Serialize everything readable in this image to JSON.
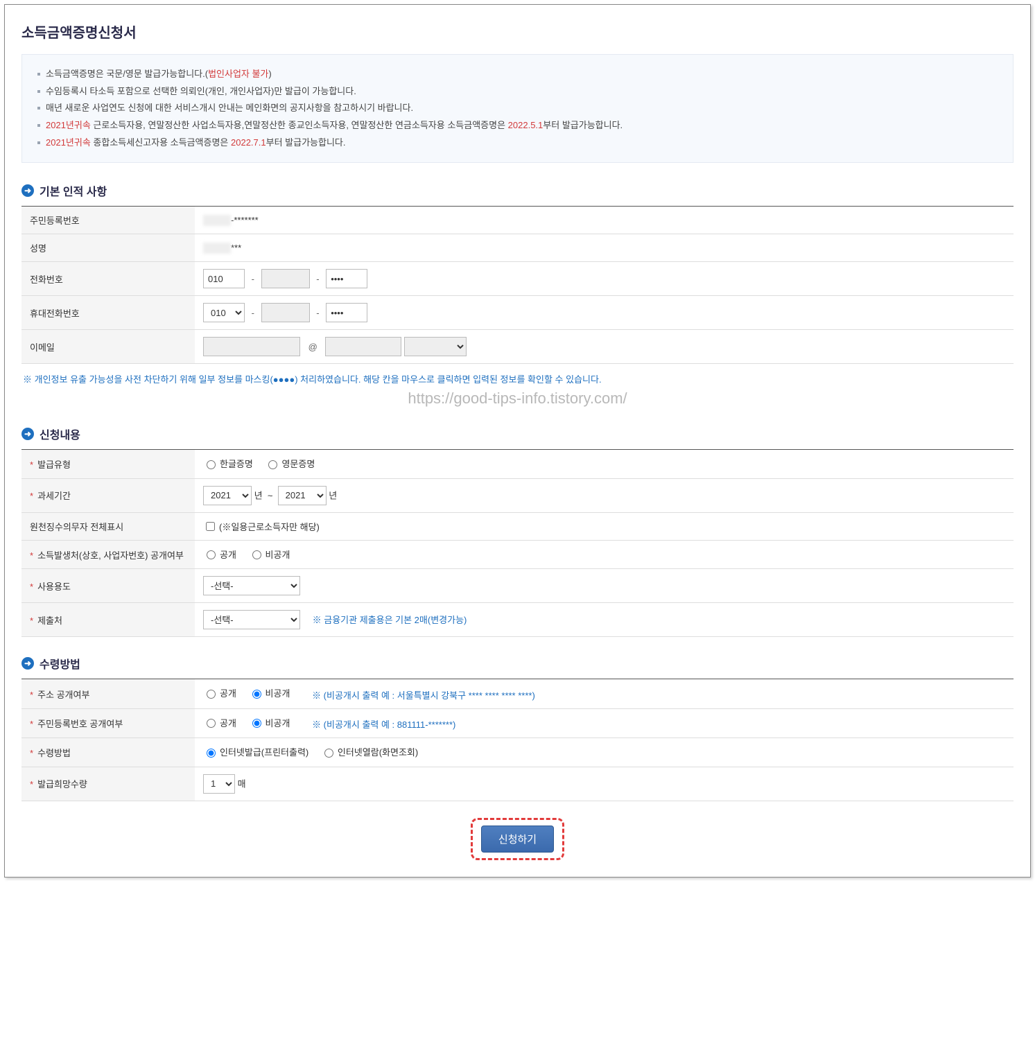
{
  "title": "소득금액증명신청서",
  "notices": [
    {
      "pre": "소득금액증명은 국문/영문 발급가능합니다.(",
      "red": "법인사업자 불가",
      "post": ")"
    },
    {
      "pre": "수임등록시 타소득 포함으로 선택한 의뢰인(개인, 개인사업자)만 발급이 가능합니다.",
      "red": "",
      "post": ""
    },
    {
      "pre": "매년 새로운 사업연도 신청에 대한 서비스개시 안내는 메인화면의 공지사항을 참고하시기 바랍니다.",
      "red": "",
      "post": ""
    },
    {
      "pre": "",
      "red": "2021년귀속",
      "mid": " 근로소득자용, 연말정산한 사업소득자용,연말정산한 종교인소득자용, 연말정산한 연금소득자용 소득금액증명은 ",
      "red2": "2022.5.1",
      "post": "부터 발급가능합니다."
    },
    {
      "pre": "",
      "red": "2021년귀속",
      "mid": " 종합소득세신고자용 소득금액증명은 ",
      "red2": "2022.7.1",
      "post": "부터 발급가능합니다."
    }
  ],
  "sections": {
    "personal": "기본 인적 사항",
    "apply": "신청내용",
    "receive": "수령방법"
  },
  "personal": {
    "rrn_label": "주민등록번호",
    "rrn_value": "-*******",
    "name_label": "성명",
    "name_value": "***",
    "phone_label": "전화번호",
    "phone1": "010",
    "phone2": "",
    "phone3": "••••",
    "mobile_label": "휴대전화번호",
    "mobile1": "010",
    "mobile2": "",
    "mobile3": "••••",
    "email_label": "이메일",
    "email_id": "",
    "email_domain": "",
    "email_select": ""
  },
  "masking_note": "개인정보 유출 가능성을 사전 차단하기 위해 일부 정보를 마스킹(●●●●) 처리하였습니다. 해당 칸을 마우스로 클릭하면 입력된 정보를 확인할 수 있습니다.",
  "watermark": "https://good-tips-info.tistory.com/",
  "apply": {
    "type_label": "발급유형",
    "type_kor": "한글증명",
    "type_eng": "영문증명",
    "period_label": "과세기간",
    "year_from": "2021",
    "year_to": "2021",
    "year_unit": "년",
    "tilde": "~",
    "withhold_label": "원천징수의무자 전체표시",
    "withhold_hint": "(※일용근로소득자만 해당)",
    "source_label": "소득발생처(상호, 사업자번호) 공개여부",
    "open": "공개",
    "closed": "비공개",
    "purpose_label": "사용용도",
    "purpose_select": "-선택-",
    "submit_to_label": "제출처",
    "submit_to_select": "-선택-",
    "submit_to_hint": "※ 금융기관 제출용은 기본 2매(변경가능)"
  },
  "receive": {
    "addr_label": "주소 공개여부",
    "addr_hint": "※ (비공개시 출력 예 : 서울특별시 강북구 **** **** **** ****)",
    "rrn_label": "주민등록번호 공개여부",
    "rrn_hint": "※ (비공개시 출력 예 : 881111-*******)",
    "method_label": "수령방법",
    "method_print": "인터넷발급(프린터출력)",
    "method_view": "인터넷열람(화면조회)",
    "qty_label": "발급희망수량",
    "qty_value": "1",
    "qty_unit": "매"
  },
  "submit": "신청하기"
}
